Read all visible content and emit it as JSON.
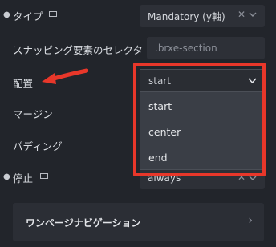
{
  "rows": {
    "type": {
      "label": "タイプ",
      "value": "Mandatory (y軸)"
    },
    "snap_selector": {
      "label": "スナッピング要素のセレクタ",
      "value": ".brxe-section"
    },
    "align": {
      "label": "配置"
    },
    "margin": {
      "label": "マージン"
    },
    "padding": {
      "label": "パディング"
    },
    "stop": {
      "label": "停止",
      "value": "always"
    }
  },
  "dropdown": {
    "selected": "start",
    "options": [
      "start",
      "center",
      "end"
    ]
  },
  "section": {
    "title": "ワンページナビゲーション"
  },
  "colors": {
    "highlight": "#e8372a",
    "background": "#22252b"
  }
}
